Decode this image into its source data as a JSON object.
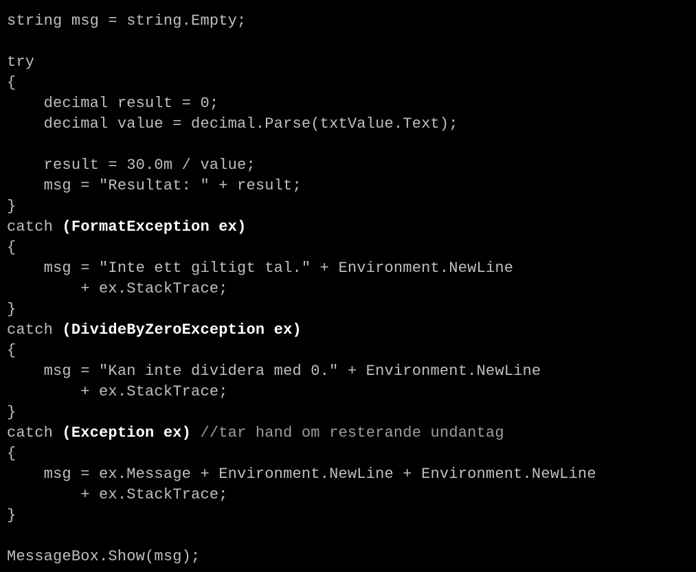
{
  "code": {
    "l01": "string msg = string.Empty;",
    "l02": "",
    "l03": "try",
    "l04": "{",
    "l05": "    decimal result = 0;",
    "l06": "    decimal value = decimal.Parse(txtValue.Text);",
    "l07": "",
    "l08": "    result = 30.0m / value;",
    "l09": "    msg = \"Resultat: \" + result;",
    "l10": "}",
    "l11a": "catch ",
    "l11b": "(FormatException ex)",
    "l12": "{",
    "l13": "    msg = \"Inte ett giltigt tal.\" + Environment.NewLine",
    "l14": "        + ex.StackTrace;",
    "l15": "}",
    "l16a": "catch ",
    "l16b": "(DivideByZeroException ex)",
    "l17": "{",
    "l18": "    msg = \"Kan inte dividera med 0.\" + Environment.NewLine",
    "l19": "        + ex.StackTrace;",
    "l20": "}",
    "l21a": "catch ",
    "l21b": "(Exception ex)",
    "l21c": " //tar hand om resterande undantag",
    "l22": "{",
    "l23": "    msg = ex.Message + Environment.NewLine + Environment.NewLine",
    "l24": "        + ex.StackTrace;",
    "l25": "}",
    "l26": "",
    "l27": "MessageBox.Show(msg);"
  }
}
